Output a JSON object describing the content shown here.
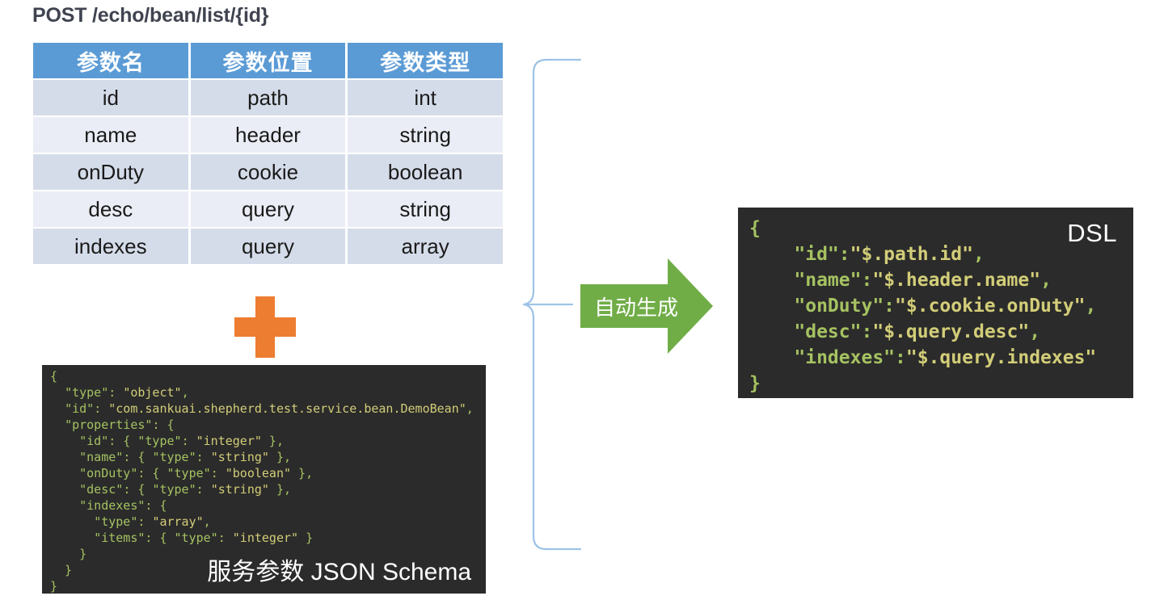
{
  "page": {
    "endpoint_title": "POST /echo/bean/list/{id}"
  },
  "params_table": {
    "headers": [
      "参数名",
      "参数位置",
      "参数类型"
    ],
    "rows": [
      [
        "id",
        "path",
        "int"
      ],
      [
        "name",
        "header",
        "string"
      ],
      [
        "onDuty",
        "cookie",
        "boolean"
      ],
      [
        "desc",
        "query",
        "string"
      ],
      [
        "indexes",
        "query",
        "array"
      ]
    ]
  },
  "plus": {
    "icon": "plus-icon",
    "color": "#ED7D31"
  },
  "schema_panel": {
    "caption": "服务参数 JSON Schema",
    "background": "#2B2B2B",
    "key_color": "#A5C261",
    "value_color": "#D2CD78",
    "lines": [
      "{",
      "  \"type\": \"object\",",
      "  \"id\": \"com.sankuai.shepherd.test.service.bean.DemoBean\",",
      "  \"properties\": {",
      "    \"id\": { \"type\": \"integer\" },",
      "    \"name\": { \"type\": \"string\" },",
      "    \"onDuty\": { \"type\": \"boolean\" },",
      "    \"desc\": { \"type\": \"string\" },",
      "    \"indexes\": {",
      "      \"type\": \"array\",",
      "      \"items\": { \"type\": \"integer\" }",
      "    }",
      "  }",
      "}"
    ]
  },
  "dsl_panel": {
    "label": "DSL",
    "background": "#2B2B2B",
    "key_color": "#A5C261",
    "value_color": "#D2CD78",
    "lines": [
      "{",
      "    \"id\":\"$.path.id\",",
      "    \"name\":\"$.header.name\",",
      "    \"onDuty\":\"$.cookie.onDuty\",",
      "    \"desc\":\"$.query.desc\",",
      "    \"indexes\":\"$.query.indexes\"",
      "}"
    ],
    "entries": [
      {
        "key": "id",
        "value": "$.path.id"
      },
      {
        "key": "name",
        "value": "$.header.name"
      },
      {
        "key": "onDuty",
        "value": "$.cookie.onDuty"
      },
      {
        "key": "desc",
        "value": "$.query.desc"
      },
      {
        "key": "indexes",
        "value": "$.query.indexes"
      }
    ]
  },
  "arrow": {
    "label": "自动生成",
    "color": "#70AD47"
  },
  "bracket": {
    "color": "#9DC3E6"
  }
}
